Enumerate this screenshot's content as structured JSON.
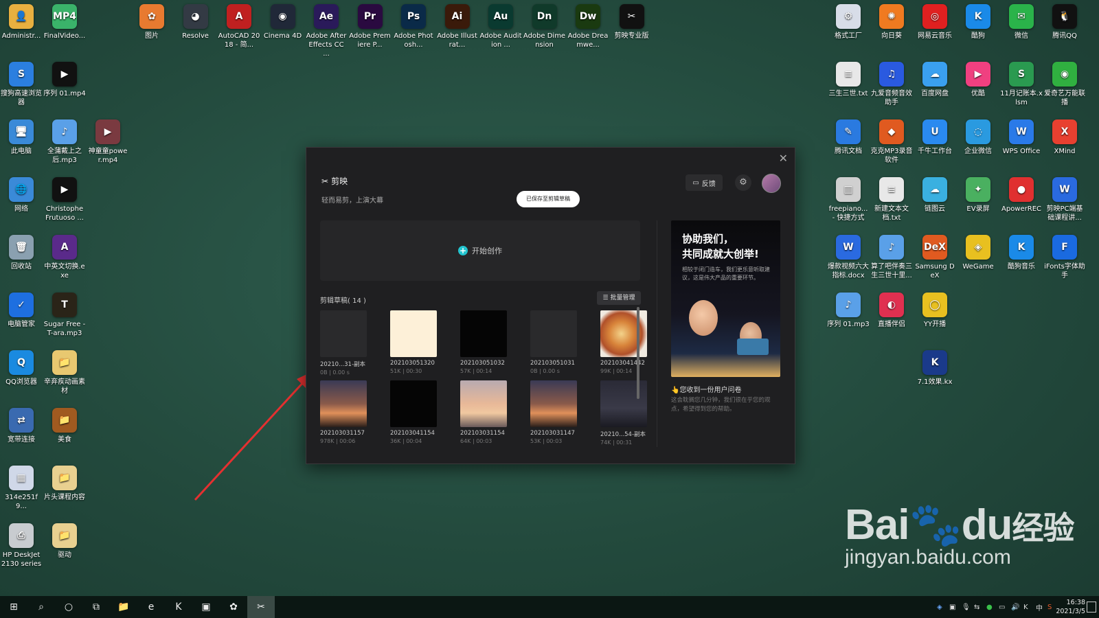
{
  "desktop_icons_left": [
    {
      "label": "Administr...",
      "color": "#e8b040",
      "glyph": "👤"
    },
    {
      "label": "FinalVideo...",
      "color": "#3ab36a",
      "glyph": "MP4"
    },
    {
      "label": "搜狗高速浏览器",
      "color": "#2b7fe0",
      "glyph": "S"
    },
    {
      "label": "序列 01.mp4",
      "color": "#111111",
      "glyph": "▶"
    },
    {
      "label": "此电脑",
      "color": "#3a8ad8",
      "glyph": "🖥"
    },
    {
      "label": "全蒲戴上之后.mp3",
      "color": "#5aa0e8",
      "glyph": "♪"
    },
    {
      "label": "神童童power.mp4",
      "color": "#7a3a40",
      "glyph": "▶"
    },
    {
      "label": "网络",
      "color": "#3a8ad8",
      "glyph": "🌐"
    },
    {
      "label": "Christophe Frutuoso ...",
      "color": "#111111",
      "glyph": "▶"
    },
    {
      "label": "回收站",
      "color": "#8aa0b0",
      "glyph": "🗑"
    },
    {
      "label": "中英文切换.exe",
      "color": "#5a2a8a",
      "glyph": "A"
    },
    {
      "label": "电脑管家",
      "color": "#1e6fe0",
      "glyph": "✓"
    },
    {
      "label": "Sugar Free -T-ara.mp3",
      "color": "#2a2418",
      "glyph": "T"
    },
    {
      "label": "QQ浏览器",
      "color": "#1a8ae0",
      "glyph": "Q"
    },
    {
      "label": "辛弃疾动画素材",
      "color": "#e8c870",
      "glyph": "📁"
    },
    {
      "label": "宽带连接",
      "color": "#3a6ab0",
      "glyph": "⇄"
    },
    {
      "label": "美食",
      "color": "#a05a20",
      "glyph": "📁"
    },
    {
      "label": "314e251f9...",
      "color": "#d0d8e8",
      "glyph": "▦"
    },
    {
      "label": "片头课程内容",
      "color": "#e8d090",
      "glyph": "📁"
    },
    {
      "label": "HP DeskJet 2130 series",
      "color": "#c8ccd0",
      "glyph": "⎙"
    },
    {
      "label": "驱动",
      "color": "#e8d090",
      "glyph": "📁"
    }
  ],
  "desktop_icons_top": [
    {
      "label": "图片",
      "color": "#e87a30",
      "glyph": "✿"
    },
    {
      "label": "Resolve",
      "color": "#333a44",
      "glyph": "◕"
    },
    {
      "label": "AutoCAD 2018 - 简...",
      "color": "#c02020",
      "glyph": "A"
    },
    {
      "label": "Cinema 4D",
      "color": "#202838",
      "glyph": "◉"
    },
    {
      "label": "Adobe After Effects CC ...",
      "color": "#2a1a5a",
      "glyph": "Ae"
    },
    {
      "label": "Adobe Premiere P...",
      "color": "#2a0a40",
      "glyph": "Pr"
    },
    {
      "label": "Adobe Photosh...",
      "color": "#0a2a48",
      "glyph": "Ps"
    },
    {
      "label": "Adobe Illustrat...",
      "color": "#3a1a0a",
      "glyph": "Ai"
    },
    {
      "label": "Adobe Audition ...",
      "color": "#0a3a30",
      "glyph": "Au"
    },
    {
      "label": "Adobe Dimension",
      "color": "#103a2a",
      "glyph": "Dn"
    },
    {
      "label": "Adobe Dreamwe...",
      "color": "#1a3a10",
      "glyph": "Dw"
    },
    {
      "label": "剪映专业版",
      "color": "#111111",
      "glyph": "✂"
    }
  ],
  "desktop_icons_right": [
    {
      "label": "格式工厂",
      "color": "#d8dde8",
      "glyph": "⚙"
    },
    {
      "label": "向日葵",
      "color": "#f07a20",
      "glyph": "✺"
    },
    {
      "label": "网易云音乐",
      "color": "#e02020",
      "glyph": "◎"
    },
    {
      "label": "酷狗",
      "color": "#1a8ae8",
      "glyph": "K"
    },
    {
      "label": "微信",
      "color": "#2ab34a",
      "glyph": "✉"
    },
    {
      "label": "腾讯QQ",
      "color": "#111111",
      "glyph": "🐧"
    },
    {
      "label": "三生三世.txt",
      "color": "#e8e8e8",
      "glyph": "≡"
    },
    {
      "label": "九爱音频音效助手",
      "color": "#2a5ae0",
      "glyph": "♫"
    },
    {
      "label": "百度网盘",
      "color": "#3aa0f0",
      "glyph": "☁"
    },
    {
      "label": "优酷",
      "color": "#f04080",
      "glyph": "▶"
    },
    {
      "label": "11月记账本.xlsm",
      "color": "#2a9a50",
      "glyph": "S"
    },
    {
      "label": "爱奇艺万能联播",
      "color": "#30b040",
      "glyph": "◉"
    },
    {
      "label": "腾讯文档",
      "color": "#2a7ae0",
      "glyph": "✎"
    },
    {
      "label": "克克MP3录音软件",
      "color": "#e05a20",
      "glyph": "◆"
    },
    {
      "label": "千牛工作台",
      "color": "#2a8af0",
      "glyph": "U"
    },
    {
      "label": "企业微信",
      "color": "#2a9ae0",
      "glyph": "◌"
    },
    {
      "label": "WPS Office",
      "color": "#2a7ae8",
      "glyph": "W"
    },
    {
      "label": "XMind",
      "color": "#e84030",
      "glyph": "X"
    },
    {
      "label": "freepiano... - 快捷方式",
      "color": "#d0d0d0",
      "glyph": "▥"
    },
    {
      "label": "新建文本文档.txt",
      "color": "#e8e8e8",
      "glyph": "≡"
    },
    {
      "label": "链图云",
      "color": "#3ab0e0",
      "glyph": "☁"
    },
    {
      "label": "EV录屏",
      "color": "#4ab060",
      "glyph": "✦"
    },
    {
      "label": "ApowerREC",
      "color": "#e03030",
      "glyph": "●"
    },
    {
      "label": "剪映PC端基础课程讲...",
      "color": "#2a6ae0",
      "glyph": "W"
    },
    {
      "label": "爆款视频六大指标.docx",
      "color": "#2a6ae0",
      "glyph": "W"
    },
    {
      "label": "算了吧伴奏三生三世十里...",
      "color": "#5aa0e8",
      "glyph": "♪"
    },
    {
      "label": "Samsung DeX",
      "color": "#e05a20",
      "glyph": "DeX"
    },
    {
      "label": "WeGame",
      "color": "#e8c020",
      "glyph": "◈"
    },
    {
      "label": "酷狗音乐",
      "color": "#1a8ae8",
      "glyph": "K"
    },
    {
      "label": "iFonts字体助手",
      "color": "#1a6ae0",
      "glyph": "F"
    },
    {
      "label": "序列 01.mp3",
      "color": "#5aa0e8",
      "glyph": "♪"
    },
    {
      "label": "直播伴侣",
      "color": "#e03050",
      "glyph": "◐"
    },
    {
      "label": "YY开播",
      "color": "#e8c020",
      "glyph": "◯"
    },
    {
      "label": "7.1效果.kx",
      "color": "#1a3a8a",
      "glyph": "K"
    }
  ],
  "dialog": {
    "app_name": "剪映",
    "slogan": "轻而易剪，上演大幕",
    "saved_pill": "已保存至剪辑草稿",
    "feedback_label": "反馈",
    "close_glyph": "✕",
    "settings_glyph": "⚙",
    "create_label": "开始创作",
    "drafts_title": "剪辑草稿( 14 )",
    "batch_label": "批量管理",
    "drafts": [
      {
        "name": "20210...31-副本",
        "meta": "0B | 0.00 s",
        "thumb": "#2a2a2c"
      },
      {
        "name": "202103051320",
        "meta": "51K | 00:30",
        "thumb": "#fdf0d8"
      },
      {
        "name": "202103051032",
        "meta": "57K | 00:14",
        "thumb": "#050505"
      },
      {
        "name": "202103051031",
        "meta": "0B | 0.00 s",
        "thumb": "#2a2a2c"
      },
      {
        "name": "202103041442",
        "meta": "99K | 00:14",
        "thumb": "food"
      },
      {
        "name": "202103031157",
        "meta": "978K | 00:06",
        "thumb": "sunset"
      },
      {
        "name": "202103041154",
        "meta": "36K | 00:04",
        "thumb": "#050505"
      },
      {
        "name": "202103031154",
        "meta": "64K | 00:03",
        "thumb": "sunset-light"
      },
      {
        "name": "202103031147",
        "meta": "53K | 00:03",
        "thumb": "sunset"
      },
      {
        "name": "20210...54-副本",
        "meta": "74K | 00:31",
        "thumb": "dark-scene"
      }
    ],
    "promo": {
      "title_line1": "协助我们，",
      "title_line2": "共同成就大创举!",
      "desc": "相较于闭门造车，我们更乐意听取建议，这是伟大产品的重要环节。"
    },
    "survey_title": "👆您收到一份用户问卷",
    "survey_desc": "这会耽搁您几分钟，我们很在乎您的观点，希望得到您的帮助。"
  },
  "taskbar": {
    "buttons": [
      {
        "name": "start-button",
        "glyph": "⊞"
      },
      {
        "name": "search-button",
        "glyph": "⌕"
      },
      {
        "name": "cortana-button",
        "glyph": "○"
      },
      {
        "name": "task-view-button",
        "glyph": "⧉"
      },
      {
        "name": "file-explorer-button",
        "glyph": "📁"
      },
      {
        "name": "edge-button",
        "glyph": "e"
      },
      {
        "name": "kx-app-button",
        "glyph": "K"
      },
      {
        "name": "store-button",
        "glyph": "▣"
      },
      {
        "name": "globe-app-button",
        "glyph": "✿"
      },
      {
        "name": "jianying-button",
        "glyph": "✂"
      }
    ],
    "tray_lang": "中",
    "time": "16:38",
    "date": "2021/3/5"
  },
  "watermark": {
    "brand": "Bai",
    "paw": "du",
    "cn": "经验",
    "url": "jingyan.baidu.com"
  }
}
